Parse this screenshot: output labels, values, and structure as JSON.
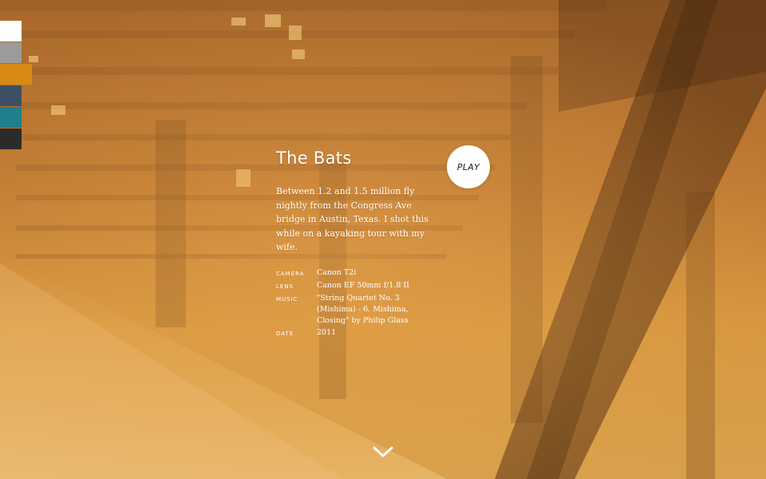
{
  "swatches": [
    {
      "name": "white",
      "color": "#ffffff",
      "active": false
    },
    {
      "name": "gray",
      "color": "#9b9b9b",
      "active": false
    },
    {
      "name": "amber",
      "color": "#d98a16",
      "active": true
    },
    {
      "name": "slate",
      "color": "#3c4f63",
      "active": false
    },
    {
      "name": "teal",
      "color": "#1f7f8a",
      "active": false
    },
    {
      "name": "charcoal",
      "color": "#2b2b2b",
      "active": false
    }
  ],
  "video": {
    "title": "The Bats",
    "description": "Between 1.2 and 1.5 million fly nightly from the Congress Ave bridge in Austin, Texas. I shot this while on a kayaking tour with my wife.",
    "meta": [
      {
        "key": "CAMERA",
        "value": "Canon T2i"
      },
      {
        "key": "LENS",
        "value": "Canon EF 50mm f/1.8 II"
      },
      {
        "key": "MUSIC",
        "value": "\"String Quartet No. 3 (Mishima) - 6. Mishima, Closing\" by Philip Glass"
      },
      {
        "key": "DATE",
        "value": "2011"
      }
    ]
  },
  "controls": {
    "play_label": "PLAY",
    "play_icon": "play-circle",
    "scroll_icon": "chevron-down-icon"
  },
  "colors": {
    "background_warm": "#c07a33",
    "text": "#ffffff",
    "play_text": "#1c1c1c"
  }
}
